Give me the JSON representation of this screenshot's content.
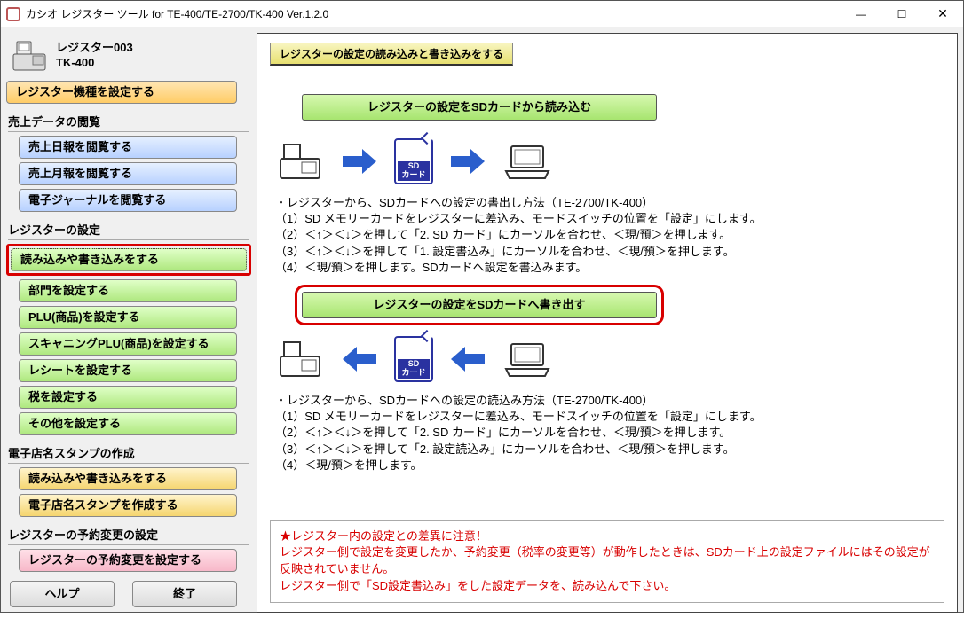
{
  "window_title": "カシオ レジスター ツール for TE-400/TE-2700/TK-400 Ver.1.2.0",
  "register": {
    "name": "レジスター003",
    "model": "TK-400"
  },
  "sidebar": {
    "configure_model": "レジスター機種を設定する",
    "sales_section": "売上データの閲覧",
    "sales": [
      "売上日報を閲覧する",
      "売上月報を閲覧する",
      "電子ジャーナルを閲覧する"
    ],
    "settings_section": "レジスターの設定",
    "rw_selected": "読み込みや書き込みをする",
    "settings": [
      "部門を設定する",
      "PLU(商品)を設定する",
      "スキャニングPLU(商品)を設定する",
      "レシートを設定する",
      "税を設定する",
      "その他を設定する"
    ],
    "stamp_section": "電子店名スタンプの作成",
    "stamp": [
      "読み込みや書き込みをする",
      "電子店名スタンプを作成する"
    ],
    "reserve_section": "レジスターの予約変更の設定",
    "reserve": "レジスターの予約変更を設定する",
    "help": "ヘルプ",
    "exit": "終了"
  },
  "main": {
    "tab": "レジスターの設定の読み込みと書き込みをする",
    "read_btn": "レジスターの設定をSDカードから読み込む",
    "write_btn": "レジスターの設定をSDカードへ書き出す",
    "sd_label1": "SD",
    "sd_label2": "カード",
    "instr_read": "・レジスターから、SDカードへの設定の書出し方法（TE-2700/TK-400）\n（1）SD メモリーカードをレジスターに差込み、モードスイッチの位置を「設定」にします。\n（2）＜↑＞＜↓＞を押して「2. SD カード」にカーソルを合わせ、＜現/預＞を押します。\n（3）＜↑＞＜↓＞を押して「1. 設定書込み」にカーソルを合わせ、＜現/預＞を押します。\n（4）＜現/預＞を押します。SDカードへ設定を書込みます。",
    "instr_write": "・レジスターから、SDカードへの設定の読込み方法（TE-2700/TK-400）\n（1）SD メモリーカードをレジスターに差込み、モードスイッチの位置を「設定」にします。\n（2）＜↑＞＜↓＞を押して「2. SD カード」にカーソルを合わせ、＜現/預＞を押します。\n（3）＜↑＞＜↓＞を押して「2. 設定読込み」にカーソルを合わせ、＜現/預＞を押します。\n（4）＜現/預＞を押します。",
    "warning": "★レジスター内の設定との差異に注意！\nレジスター側で設定を変更したか、予約変更（税率の変更等）が動作したときは、SDカード上の設定ファイルにはその設定が反映されていません。\nレジスター側で「SD設定書込み」をした設定データを、読み込んで下さい。"
  }
}
